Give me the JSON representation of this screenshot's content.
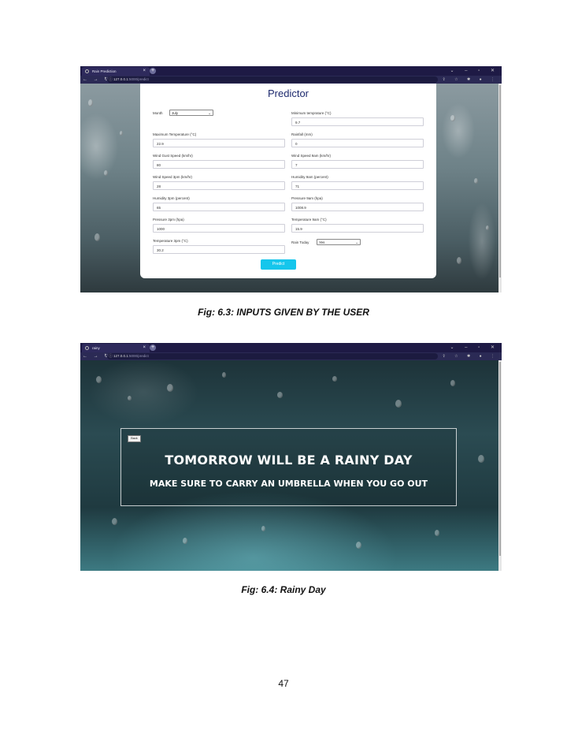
{
  "figure1": {
    "tab_title": "Rain Prediction",
    "url_host": "127.0.0.1",
    "url_path": ":5000/predict",
    "heading": "Predictor",
    "fields": {
      "month_label": "Month",
      "month_value": "July",
      "min_temp_label": "Minimum temprature (°C)",
      "min_temp_value": "9.7",
      "max_temp_label": "Maximum Temperature (°C)",
      "max_temp_value": "22.9",
      "rainfall_label": "Rainfall (mm)",
      "rainfall_value": "0",
      "wind_gust_label": "Wind Gust Speed (km/hr)",
      "wind_gust_value": "80",
      "wind_9am_label": "Wind Speed 9am (km/hr)",
      "wind_9am_value": "7",
      "wind_3pm_label": "Wind Speed 3pm (km/hr)",
      "wind_3pm_value": "28",
      "humidity_9am_label": "Humidity 9am (percent)",
      "humidity_9am_value": "71",
      "humidity_3pm_label": "Humidity 3pm (percent)",
      "humidity_3pm_value": "65",
      "pressure_9am_label": "Pressure 9am (hpa)",
      "pressure_9am_value": "1008.9",
      "pressure_3pm_label": "Pressure 3pm (hpa)",
      "pressure_3pm_value": "1000",
      "temp_9am_label": "Temperature 9am (°C)",
      "temp_9am_value": "15.9",
      "temp_3pm_label": "Temperature 3pm (°C)",
      "temp_3pm_value": "30.2",
      "rain_today_label": "Rain Today",
      "rain_today_value": "Yes"
    },
    "predict_label": "Predict",
    "caption": "Fig: 6.3: INPUTS GIVEN BY THE USER"
  },
  "figure2": {
    "tab_title": "rainy",
    "url_host": "127.0.0.1",
    "url_path": ":5000/predict",
    "back_label": "Back",
    "headline": "TOMORROW WILL BE A RAINY DAY",
    "subline": "MAKE SURE TO CARRY AN UMBRELLA WHEN YOU GO OUT",
    "caption": "Fig: 6.4: Rainy Day"
  },
  "page_number": "47",
  "colors": {
    "accent_button": "#15c6ec",
    "heading": "#1e2a6e",
    "browser_frame": "#1e1a45"
  }
}
